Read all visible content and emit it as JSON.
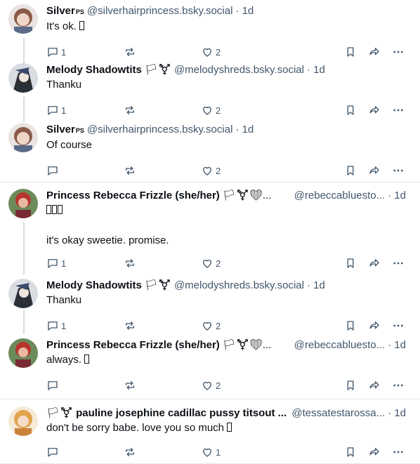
{
  "posts": [
    {
      "name": "Silver",
      "name_badge": "PS",
      "handle": "@silverhairprincess.bsky.social",
      "time": "· 1d",
      "text": "It's ok.",
      "emoji_boxes": 1,
      "replies": "1",
      "reposts": "",
      "likes": "2",
      "avatar_color": "#b78f7a"
    },
    {
      "name": "Melody Shadowtits",
      "name_suffix": "🏳⚧",
      "handle": "@melodyshreds.bsky.social",
      "time": "· 1d",
      "text": "Thanku",
      "replies": "1",
      "reposts": "",
      "likes": "2",
      "avatar_color": "#55606b"
    },
    {
      "name": "Silver",
      "name_badge": "PS",
      "handle": "@silverhairprincess.bsky.social",
      "time": "· 1d",
      "text": "Of course",
      "replies": "",
      "reposts": "",
      "likes": "2",
      "avatar_color": "#b78f7a"
    },
    {
      "name": "Princess Rebecca Frizzle (she/her)",
      "name_suffix": "🏳⚧❤...",
      "handle": "@rebeccabluesto...",
      "time": "· 1d",
      "text_boxes": 3,
      "text": "it's okay sweetie. promise.",
      "replies": "1",
      "reposts": "",
      "likes": "2",
      "avatar_color": "#a33a3a"
    },
    {
      "name": "Melody Shadowtits",
      "name_suffix": "🏳⚧",
      "handle": "@melodyshreds.bsky.social",
      "time": "· 1d",
      "text": "Thanku",
      "replies": "1",
      "reposts": "",
      "likes": "2",
      "avatar_color": "#55606b"
    },
    {
      "name": "Princess Rebecca Frizzle (she/her)",
      "name_suffix": "🏳⚧❤...",
      "handle": "@rebeccabluesto...",
      "time": "· 1d",
      "text": "always.",
      "emoji_boxes": 1,
      "replies": "",
      "reposts": "",
      "likes": "2",
      "avatar_color": "#a33a3a"
    },
    {
      "name": "pauline josephine cadillac pussy titsout ...",
      "name_prefix": "🏳⚧",
      "handle": "@tessatestarossa...",
      "time": "· 1d",
      "text": "don't be sorry babe. love you so much",
      "emoji_boxes": 1,
      "replies": "",
      "reposts": "",
      "likes": "1",
      "avatar_color": "#e0b070"
    }
  ]
}
